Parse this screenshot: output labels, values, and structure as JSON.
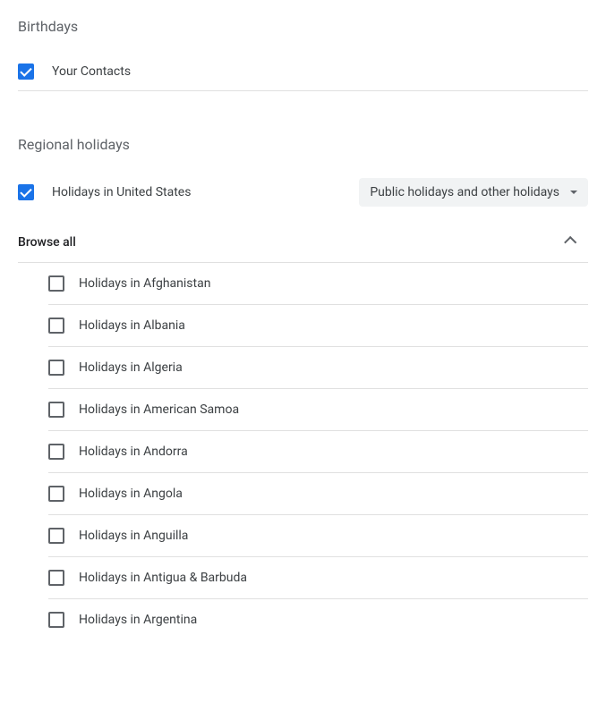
{
  "birthdays": {
    "title": "Birthdays",
    "contacts_label": "Your Contacts",
    "contacts_checked": true
  },
  "regional": {
    "title": "Regional holidays",
    "us_label": "Holidays in United States",
    "us_checked": true,
    "dropdown_label": "Public holidays and other holidays",
    "browse_all_label": "Browse all",
    "countries": [
      "Holidays in Afghanistan",
      "Holidays in Albania",
      "Holidays in Algeria",
      "Holidays in American Samoa",
      "Holidays in Andorra",
      "Holidays in Angola",
      "Holidays in Anguilla",
      "Holidays in Antigua & Barbuda",
      "Holidays in Argentina"
    ]
  }
}
